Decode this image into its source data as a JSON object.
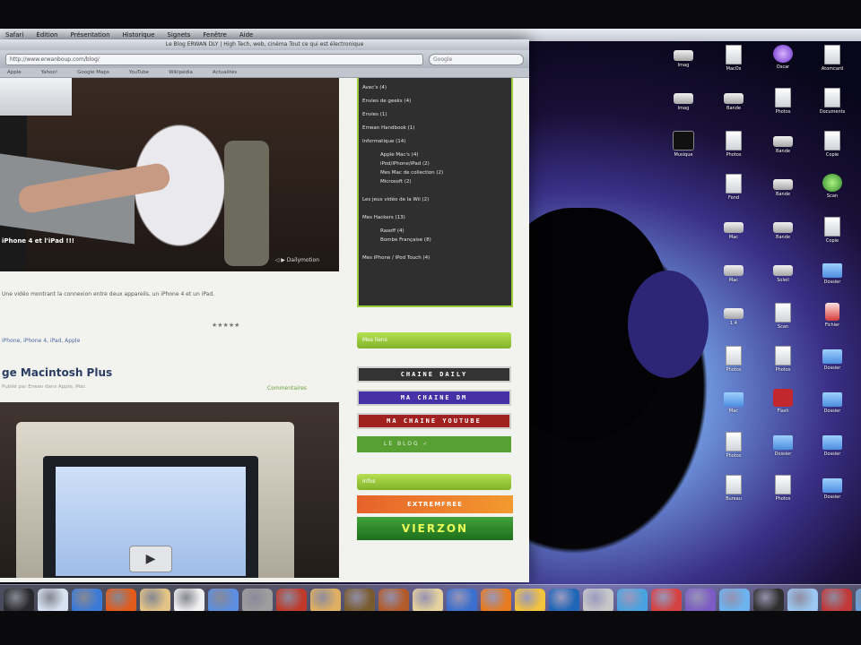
{
  "menubar": {
    "items": [
      "Safari",
      "Édition",
      "Présentation",
      "Historique",
      "Signets",
      "Fenêtre",
      "Aide"
    ]
  },
  "browser": {
    "title": "Le Blog ERWAN DLY | High Tech, web, cinéma Tout ce qui est électronique",
    "url": "http://www.erwanboup.com/blog/",
    "search_placeholder": "Google",
    "bookmarks": [
      "Apple",
      "Yahoo!",
      "Google Maps",
      "YouTube",
      "Wikipédia",
      "Actualités"
    ]
  },
  "main": {
    "video1_caption": "iPhone 4 et l'iPad !!!",
    "video1_controls": "◁ ▶ Dailymotion",
    "post_intro": "Une vidéo montrant la connexion entre deux appareils, un iPhone 4 et un iPad.",
    "rating": "★★★★★",
    "post_tags": "iPhone, iPhone 4, iPad, Apple",
    "post_title": "ge Macintosh Plus",
    "post_meta": "Publié par Erwan dans Apple, Mac",
    "comments": "Commentaires"
  },
  "sidebar": {
    "categories": [
      {
        "label": "Avec's (4)",
        "sub": false
      },
      {
        "label": "Envies de geeks (4)",
        "sub": false
      },
      {
        "label": "Envies (1)",
        "sub": false
      },
      {
        "label": "Errwan Handbook (1)",
        "sub": false
      },
      {
        "label": "Informatique (14)",
        "sub": false
      },
      {
        "label": "Apple Mac's (4)",
        "sub": true
      },
      {
        "label": "iPod/iPhone/iPad (2)",
        "sub": true
      },
      {
        "label": "Mes Mac de collection (2)",
        "sub": true
      },
      {
        "label": "Microsoft (2)",
        "sub": true
      },
      {
        "label": "Les jeux vidéo de la Wii (2)",
        "sub": false
      },
      {
        "label": "Mes Hackers (13)",
        "sub": false
      },
      {
        "label": "Rasoff (4)",
        "sub": true
      },
      {
        "label": "Bombe Française (8)",
        "sub": true
      },
      {
        "label": "Mes iPhone / iPod Touch (4)",
        "sub": false
      }
    ],
    "tab1": "Mes liens",
    "chain_daily": "CHAINE DAILY",
    "chain_dm": "MA CHAINE DM",
    "chain_yt": "MA CHAINE YOUTUBE",
    "blog_button": "LE BLOG ✓",
    "tab2": "Infos",
    "extremfree": "EXTREMFREE",
    "vienzon": "VIERZON"
  },
  "desktop_icons": [
    {
      "label": "Imag",
      "type": "drive"
    },
    {
      "label": "MacOs",
      "type": "doc"
    },
    {
      "label": "Oscar",
      "type": "orb"
    },
    {
      "label": "Atomcard",
      "type": "doc"
    },
    {
      "label": "Imag",
      "type": "drive"
    },
    {
      "label": "Bande",
      "type": "drive"
    },
    {
      "label": "Photos",
      "type": "doc"
    },
    {
      "label": "Documents",
      "type": "doc"
    },
    {
      "label": "Musique",
      "type": "music"
    },
    {
      "label": "Photos",
      "type": "doc"
    },
    {
      "label": "Bande",
      "type": "drive"
    },
    {
      "label": "Copie",
      "type": "doc"
    },
    {
      "label": "Fond",
      "type": "doc"
    },
    {
      "label": "Bande",
      "type": "drive"
    },
    {
      "label": "Scan",
      "type": "green"
    },
    {
      "label": "Mac",
      "type": "drive"
    },
    {
      "label": "Bande",
      "type": "drive"
    },
    {
      "label": "Copie",
      "type": "doc"
    },
    {
      "label": "Mac",
      "type": "drive"
    },
    {
      "label": "Soleil",
      "type": "drive"
    },
    {
      "label": "Dossier",
      "type": "folder"
    },
    {
      "label": "1.4",
      "type": "drive"
    },
    {
      "label": "Scan",
      "type": "doc"
    },
    {
      "label": "Fichier",
      "type": "red"
    },
    {
      "label": "Photos",
      "type": "doc"
    },
    {
      "label": "Photos",
      "type": "doc"
    },
    {
      "label": "Dossier",
      "type": "folder"
    },
    {
      "label": "Mac",
      "type": "folder"
    },
    {
      "label": "Flash",
      "type": "flash"
    },
    {
      "label": "Dossier",
      "type": "folder"
    },
    {
      "label": "Photos",
      "type": "doc"
    },
    {
      "label": "Dossier",
      "type": "folder"
    },
    {
      "label": "Dossier",
      "type": "folder"
    },
    {
      "label": "Bureau",
      "type": "doc"
    },
    {
      "label": "Photos",
      "type": "doc"
    },
    {
      "label": "Dossier",
      "type": "folder"
    }
  ],
  "dock_colors": [
    "#2a2a2e",
    "#d7e3f2",
    "#3c7ad8",
    "#e35b1a",
    "#e4c486",
    "#f1f1f1",
    "#5d8ee0",
    "#9e9e9e",
    "#c0392b",
    "#e0b062",
    "#7a5b2f",
    "#b35a2b",
    "#e6d29e",
    "#3a6fcf",
    "#e87b1e",
    "#f3c33d",
    "#1f66b8",
    "#c8c8c8",
    "#4aa3e0",
    "#d64141",
    "#7c5bc4",
    "#6cb3f0",
    "#2f2f2f",
    "#9bc7f0",
    "#c23838",
    "#6ca2d8",
    "#f0f0f0",
    "#8fbef0"
  ],
  "colors": {
    "sidebar_green": "#9bcc3b",
    "title_blue": "#2a3e64"
  }
}
